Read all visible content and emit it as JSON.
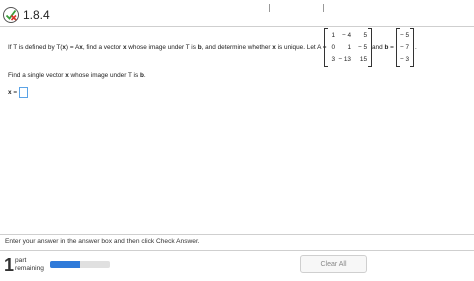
{
  "header": {
    "problem_number": "1.8.4",
    "status_icon": "partial-credit-icon"
  },
  "question": {
    "t1": "If T is defined by T(",
    "t2": "x",
    "t3": ") = A",
    "t4": "x",
    "t5": ", find a vector ",
    "t6": "x",
    "t7": " whose image under T is ",
    "t8": "b",
    "t9": ", and determine whether ",
    "t10": "x",
    "t11": " is unique. Let A =",
    "and": "and ",
    "b_bold": "b",
    "eq": " =",
    "period": "."
  },
  "matrix_A": [
    [
      "1",
      "− 4",
      "5"
    ],
    [
      "0",
      "1",
      "− 5"
    ],
    [
      "3",
      "− 13",
      "15"
    ]
  ],
  "vector_b": [
    "− 5",
    "− 7",
    "− 3"
  ],
  "subprompt": {
    "t1": "Find a single vector ",
    "t2": "x",
    "t3": " whose image under T is ",
    "t4": "b",
    "t5": "."
  },
  "answer": {
    "label_x": "x",
    "label_eq": " =",
    "value": ""
  },
  "footer": {
    "instructions": "Enter your answer in the answer box and then click Check Answer.",
    "parts_count": "1",
    "parts_line1": "part",
    "parts_line2": "remaining",
    "progress_fraction": 0.5,
    "clear_all_label": "Clear All"
  },
  "colors": {
    "progress": "#2f7ad9",
    "answer_border": "#5ba3e6",
    "icon_red": "#d9342b",
    "icon_green": "#3a9e3a"
  }
}
